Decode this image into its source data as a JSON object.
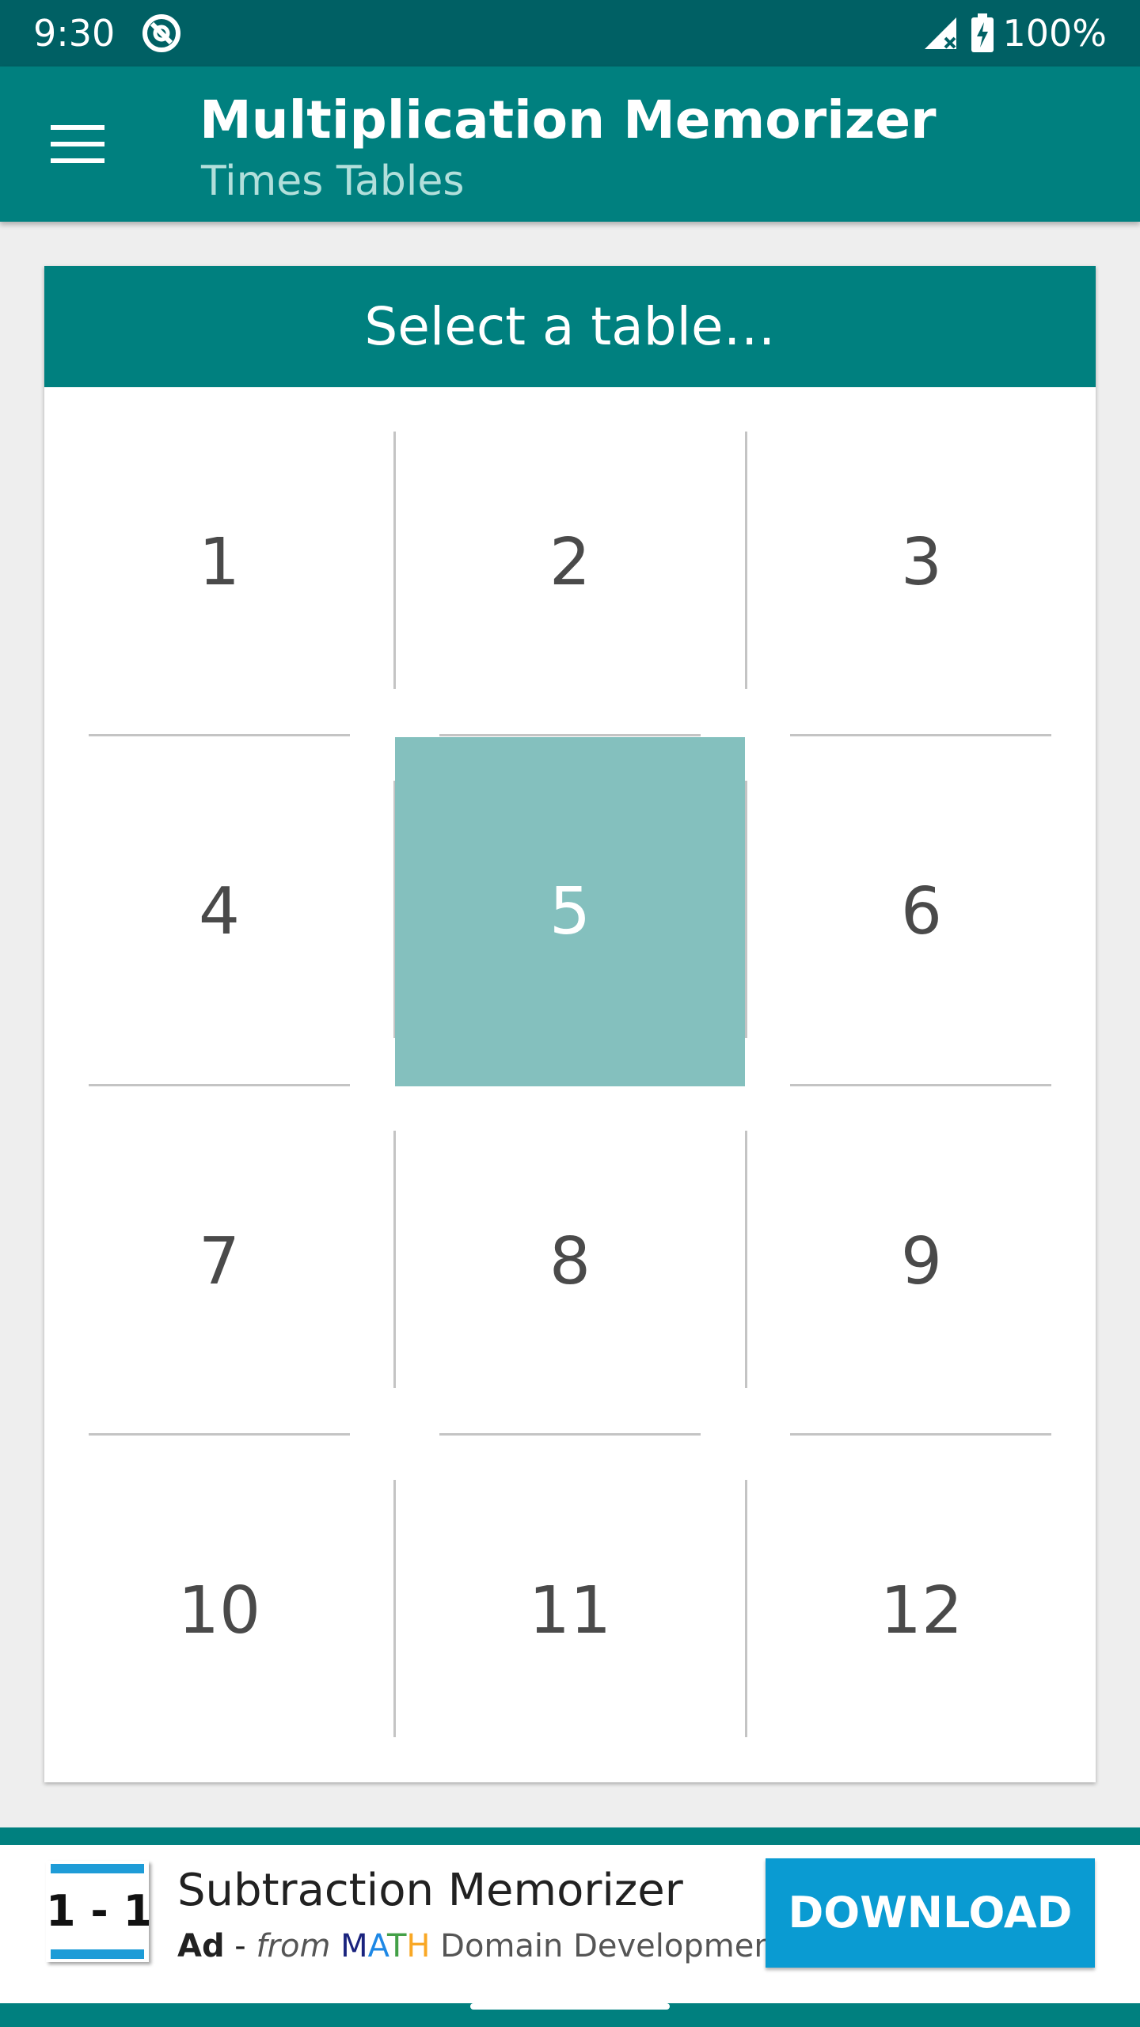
{
  "status_bar": {
    "time": "9:30",
    "battery": "100%",
    "icons": [
      "app-notification-icon",
      "signal-icon",
      "battery-charging-icon"
    ]
  },
  "app_bar": {
    "title": "Multiplication Memorizer",
    "subtitle": "Times Tables",
    "menu_icon": "hamburger-menu-icon"
  },
  "card": {
    "header": "Select a table…",
    "tables": [
      "1",
      "2",
      "3",
      "4",
      "5",
      "6",
      "7",
      "8",
      "9",
      "10",
      "11",
      "12"
    ],
    "selected": "5"
  },
  "ad": {
    "logo_text": "1 - 1",
    "title": "Subtraction Memorizer",
    "label": "Ad",
    "separator": " - ",
    "from": "from",
    "brand_letters": [
      "M",
      "A",
      "T",
      "H"
    ],
    "developer": "Domain Development",
    "button_label": "DOWNLOAD"
  },
  "colors": {
    "status_bar": "#006064",
    "primary": "#00807f",
    "selected_cell": "#84c0be",
    "download_button": "#0a9bd2"
  }
}
